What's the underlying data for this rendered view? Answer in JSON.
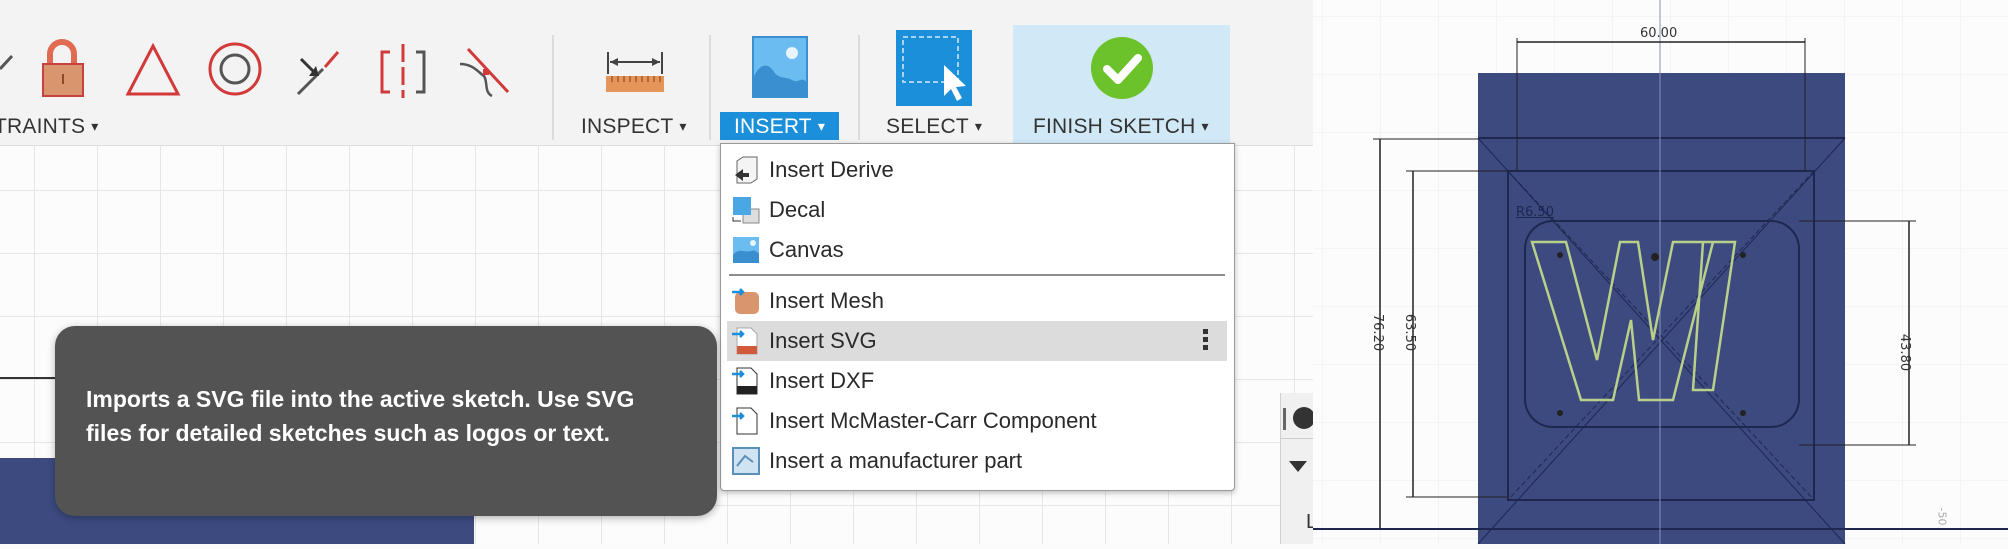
{
  "toolbar": {
    "groups": [
      {
        "label": "TRAINTS",
        "caret": "▾"
      },
      {
        "label": "INSPECT",
        "caret": "▾"
      },
      {
        "label": "INSERT",
        "caret": "▾"
      },
      {
        "label": "SELECT",
        "caret": "▾"
      },
      {
        "label": "FINISH SKETCH",
        "caret": "▾"
      }
    ],
    "constraint_icons": [
      "check-icon",
      "fix-lock-icon",
      "equal-triangle-icon",
      "concentric-icon",
      "midpoint-icon",
      "symmetry-icon",
      "curvature-icon"
    ],
    "inspect_icon": "measure-ruler-icon",
    "insert_icon": "insert-image-icon",
    "select_icon": "window-select-icon",
    "finish_icon": "green-check-icon",
    "accent": "#1b8fd9",
    "finish_bg": "#d1e8f6"
  },
  "insert_menu": {
    "items": [
      {
        "label": "Insert Derive",
        "icon": "derive-icon"
      },
      {
        "label": "Decal",
        "icon": "decal-icon"
      },
      {
        "label": "Canvas",
        "icon": "canvas-icon"
      },
      {
        "label": "Insert Mesh",
        "icon": "mesh-icon"
      },
      {
        "label": "Insert SVG",
        "icon": "svg-file-icon",
        "highlighted": true
      },
      {
        "label": "Insert DXF",
        "icon": "dxf-file-icon"
      },
      {
        "label": "Insert McMaster-Carr Component",
        "icon": "mcmaster-icon"
      },
      {
        "label": "Insert a manufacturer part",
        "icon": "manufacturer-part-icon"
      }
    ]
  },
  "tooltip": {
    "text": "Imports a SVG file into the active sketch. Use SVG files for detailed sketches such as logos or text."
  },
  "sketch": {
    "dimensions": {
      "width": "60.00",
      "outer_height": "76.20",
      "inner_height": "63.50",
      "pocket_height": "43.80",
      "radius": "R6.50",
      "axis_label": "-50"
    },
    "profile_color": "#3d4a80",
    "text_outline_color": "#b8d08a"
  },
  "side_panel": {
    "label": "L"
  }
}
